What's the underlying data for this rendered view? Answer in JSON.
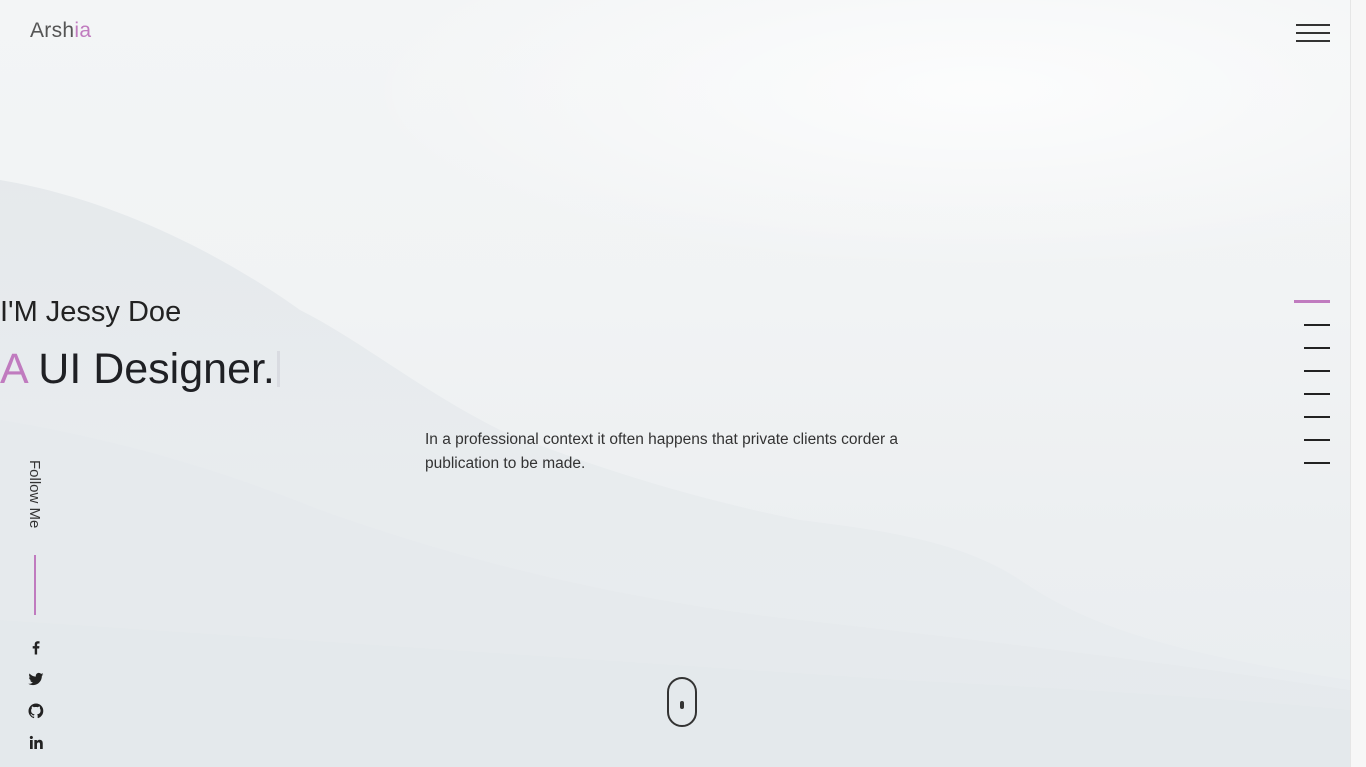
{
  "logo": {
    "text_main": "Arsh",
    "text_accent": "ia"
  },
  "hero": {
    "greeting": "I'M Jessy Doe",
    "role_article": "A",
    "role_text": "UI Designer.",
    "description": "In a professional context it often happens that private clients corder a publication to be made."
  },
  "sidebar": {
    "follow_label": "Follow Me",
    "social": [
      {
        "icon": "facebook-icon"
      },
      {
        "icon": "twitter-icon"
      },
      {
        "icon": "github-icon"
      },
      {
        "icon": "linkedin-icon"
      }
    ]
  },
  "nav_dots": {
    "count": 8,
    "active_index": 0
  },
  "colors": {
    "accent": "#c07bbf",
    "text": "#222222",
    "background": "#eef1f3"
  }
}
